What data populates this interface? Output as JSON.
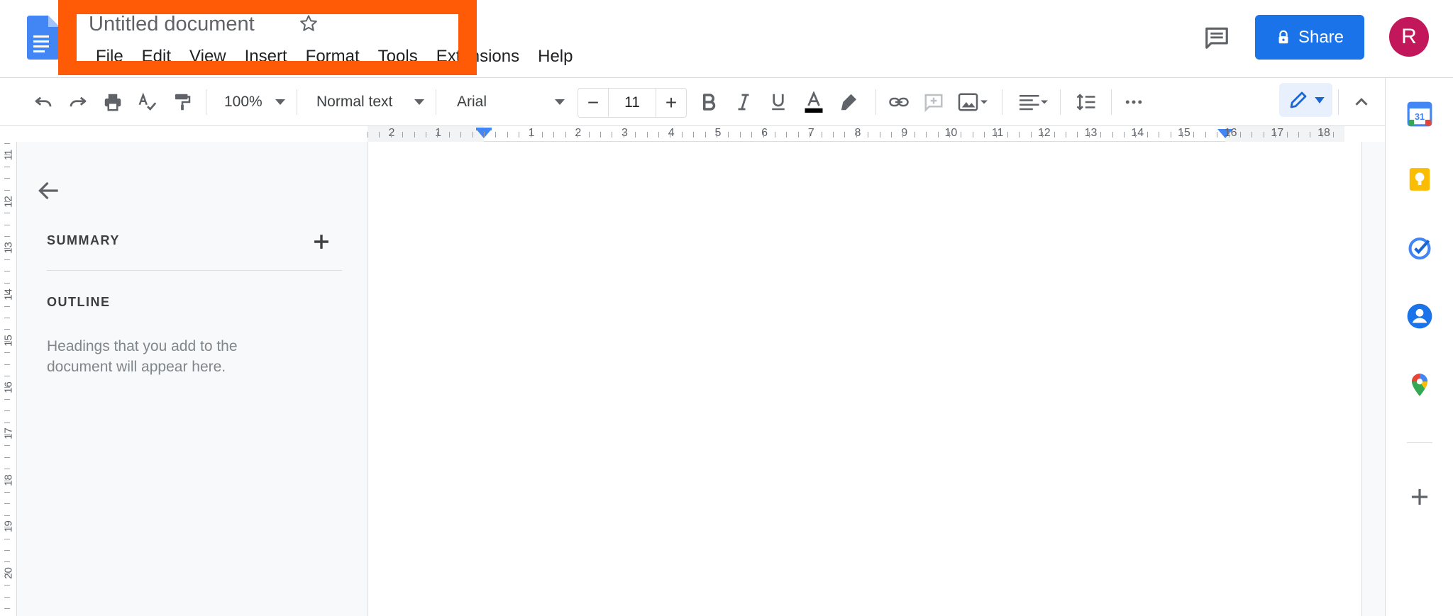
{
  "header": {
    "title": "Untitled document",
    "menu": [
      "File",
      "Edit",
      "View",
      "Insert",
      "Format",
      "Tools",
      "Extensions",
      "Help"
    ],
    "share_label": "Share",
    "avatar_initial": "R",
    "colors": {
      "share": "#1a73e8",
      "avatar": "#c2185b",
      "highlight": "#ff5b06"
    }
  },
  "toolbar": {
    "zoom": "100%",
    "style": "Normal text",
    "font": "Arial",
    "font_size": "11",
    "font_size_minus": "−",
    "font_size_plus": "+"
  },
  "ruler": {
    "numbers": [
      "2",
      "1",
      "1",
      "2",
      "3",
      "4",
      "5",
      "6",
      "7",
      "8",
      "9",
      "10",
      "11",
      "12",
      "13",
      "14",
      "15",
      "16",
      "17",
      "18"
    ],
    "vertical_numbers": [
      "11",
      "12",
      "13",
      "14",
      "15",
      "16",
      "17",
      "18",
      "19",
      "20"
    ]
  },
  "sidebar": {
    "summary_label": "SUMMARY",
    "outline_label": "OUTLINE",
    "outline_hint": "Headings that you add to the document will appear here."
  },
  "side_panel": {
    "icons": [
      "calendar-icon",
      "keep-icon",
      "tasks-icon",
      "contacts-icon",
      "maps-icon",
      "add-icon"
    ],
    "calendar_day": "31"
  }
}
